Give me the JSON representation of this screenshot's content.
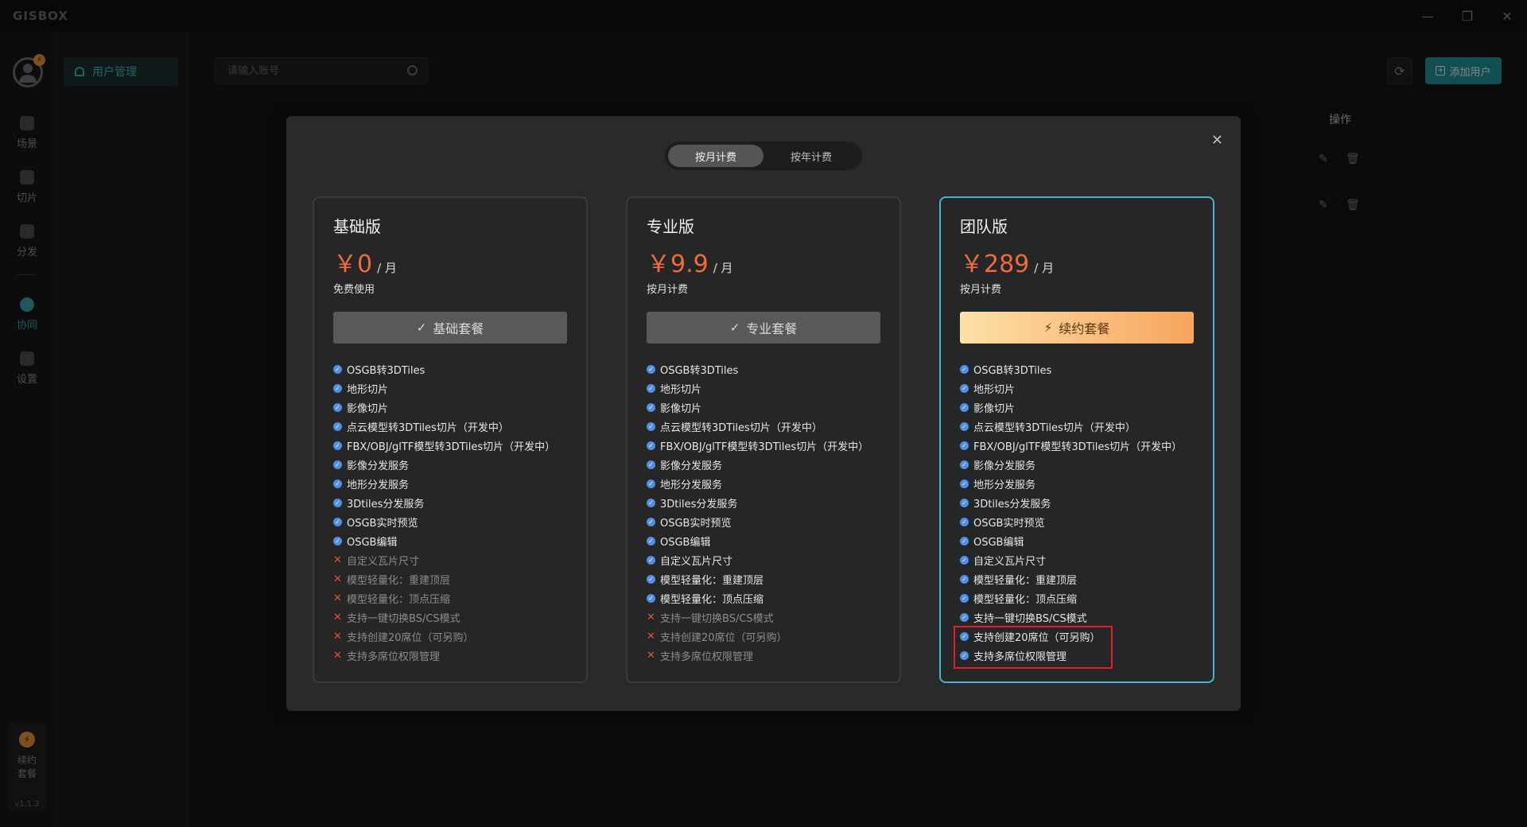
{
  "app": {
    "logo": "GISBOX"
  },
  "window_controls": {
    "minimize": "—",
    "restore": "❐",
    "close": "✕"
  },
  "rail": {
    "avatar_badge": "⚡",
    "items": [
      {
        "label": "场景",
        "icon": "home-icon"
      },
      {
        "label": "切片",
        "icon": "slice-icon"
      },
      {
        "label": "分发",
        "icon": "distribute-icon"
      },
      {
        "label": "协同",
        "icon": "lock-icon"
      },
      {
        "label": "设置",
        "icon": "gear-icon"
      }
    ],
    "renew": {
      "icon": "⚡",
      "label": "续约套餐"
    },
    "version": "v1.1.2"
  },
  "subnav": {
    "active_item": "用户管理"
  },
  "main": {
    "search_placeholder": "请输入账号",
    "add_user_label": "添加用户",
    "refresh": "⟳",
    "ops_header": "操作",
    "row_edit_icon": "✎",
    "row_delete_icon": "🗑"
  },
  "modal": {
    "close": "✕",
    "tabs": [
      {
        "label": "按月计费",
        "active": true
      },
      {
        "label": "按年计费",
        "active": false
      }
    ],
    "plans": [
      {
        "name": "基础版",
        "price": "￥0",
        "unit": "/ 月",
        "desc": "免费使用",
        "button": "基础套餐",
        "button_icon": "✓",
        "primary": false,
        "features": [
          {
            "text": "OSGB转3DTiles",
            "ok": true
          },
          {
            "text": "地形切片",
            "ok": true
          },
          {
            "text": "影像切片",
            "ok": true
          },
          {
            "text": "点云模型转3DTiles切片（开发中）",
            "ok": true
          },
          {
            "text": "FBX/OBJ/glTF模型转3DTiles切片（开发中）",
            "ok": true
          },
          {
            "text": "影像分发服务",
            "ok": true
          },
          {
            "text": "地形分发服务",
            "ok": true
          },
          {
            "text": "3Dtiles分发服务",
            "ok": true
          },
          {
            "text": "OSGB实时预览",
            "ok": true
          },
          {
            "text": "OSGB编辑",
            "ok": true
          },
          {
            "text": "自定义瓦片尺寸",
            "ok": false
          },
          {
            "text": "模型轻量化：重建顶层",
            "ok": false
          },
          {
            "text": "模型轻量化：顶点压缩",
            "ok": false
          },
          {
            "text": "支持一键切换BS/CS模式",
            "ok": false
          },
          {
            "text": "支持创建20席位（可另购）",
            "ok": false
          },
          {
            "text": "支持多席位权限管理",
            "ok": false
          }
        ]
      },
      {
        "name": "专业版",
        "price": "￥9.9",
        "unit": "/ 月",
        "desc": "按月计费",
        "button": "专业套餐",
        "button_icon": "✓",
        "primary": false,
        "features": [
          {
            "text": "OSGB转3DTiles",
            "ok": true
          },
          {
            "text": "地形切片",
            "ok": true
          },
          {
            "text": "影像切片",
            "ok": true
          },
          {
            "text": "点云模型转3DTiles切片（开发中）",
            "ok": true
          },
          {
            "text": "FBX/OBJ/glTF模型转3DTiles切片（开发中）",
            "ok": true
          },
          {
            "text": "影像分发服务",
            "ok": true
          },
          {
            "text": "地形分发服务",
            "ok": true
          },
          {
            "text": "3Dtiles分发服务",
            "ok": true
          },
          {
            "text": "OSGB实时预览",
            "ok": true
          },
          {
            "text": "OSGB编辑",
            "ok": true
          },
          {
            "text": "自定义瓦片尺寸",
            "ok": true
          },
          {
            "text": "模型轻量化：重建顶层",
            "ok": true
          },
          {
            "text": "模型轻量化：顶点压缩",
            "ok": true
          },
          {
            "text": "支持一键切换BS/CS模式",
            "ok": false
          },
          {
            "text": "支持创建20席位（可另购）",
            "ok": false
          },
          {
            "text": "支持多席位权限管理",
            "ok": false
          }
        ]
      },
      {
        "name": "团队版",
        "price": "￥289",
        "unit": "/ 月",
        "desc": "按月计费",
        "button": "续约套餐",
        "button_icon": "⚡",
        "primary": true,
        "features": [
          {
            "text": "OSGB转3DTiles",
            "ok": true
          },
          {
            "text": "地形切片",
            "ok": true
          },
          {
            "text": "影像切片",
            "ok": true
          },
          {
            "text": "点云模型转3DTiles切片（开发中）",
            "ok": true
          },
          {
            "text": "FBX/OBJ/glTF模型转3DTiles切片（开发中）",
            "ok": true
          },
          {
            "text": "影像分发服务",
            "ok": true
          },
          {
            "text": "地形分发服务",
            "ok": true
          },
          {
            "text": "3Dtiles分发服务",
            "ok": true
          },
          {
            "text": "OSGB实时预览",
            "ok": true
          },
          {
            "text": "OSGB编辑",
            "ok": true
          },
          {
            "text": "自定义瓦片尺寸",
            "ok": true
          },
          {
            "text": "模型轻量化：重建顶层",
            "ok": true
          },
          {
            "text": "模型轻量化：顶点压缩",
            "ok": true
          },
          {
            "text": "支持一键切换BS/CS模式",
            "ok": true
          },
          {
            "text": "支持创建20席位（可另购）",
            "ok": true
          },
          {
            "text": "支持多席位权限管理",
            "ok": true
          }
        ]
      }
    ]
  },
  "colors": {
    "accent": "#1e8e96",
    "price": "#f06a3c",
    "highlight_border": "#45b5c9",
    "annotation_box": "#e51c23"
  }
}
